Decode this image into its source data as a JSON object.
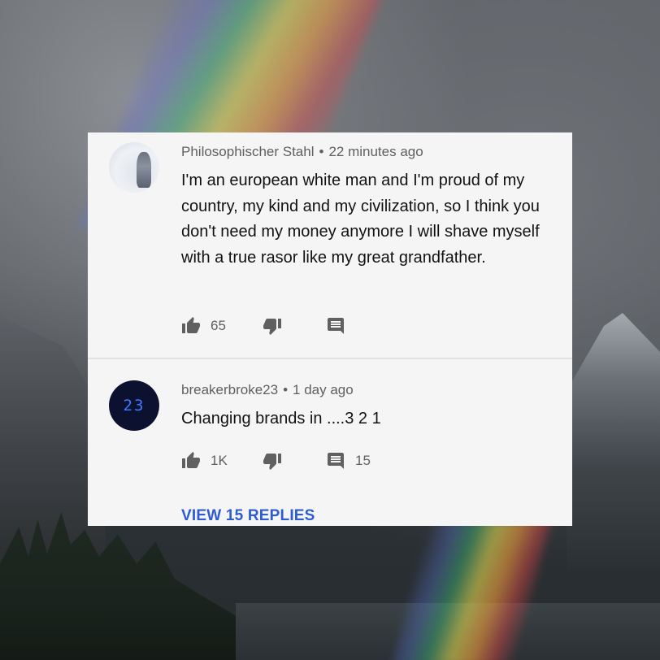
{
  "comments": [
    {
      "author": "Philosophischer Stahl",
      "separator": "•",
      "time": "22 minutes ago",
      "text": "I'm an european white man and I'm proud of my country, my kind and my civilization, so I think you don't need my money anymore I will shave myself with a true rasor like my great grandfather.",
      "likes": "65",
      "replies": ""
    },
    {
      "author": "breakerbroke23",
      "separator": "•",
      "time": "1 day ago",
      "avatar_text": "23",
      "text": "Changing brands in ....3 2 1",
      "likes": "1K",
      "replies": "15",
      "view_replies_label": "VIEW 15 REPLIES"
    }
  ],
  "colors": {
    "card": "#f5f5f5",
    "text": "#121212",
    "meta": "#606060",
    "link": "#2d5bd3"
  },
  "icons": [
    "thumbs-up-icon",
    "thumbs-down-icon",
    "reply-icon",
    "more-vert-icon"
  ]
}
